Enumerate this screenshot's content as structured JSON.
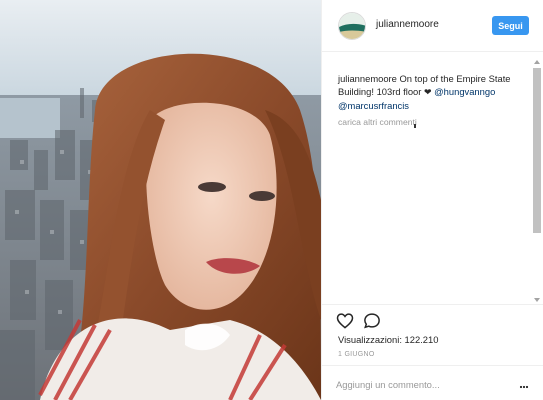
{
  "header": {
    "username": "juliannemoore",
    "follow_label": "Segui"
  },
  "caption": {
    "username": "juliannemoore",
    "text_1": " On top of the Empire State Building! 103rd floor ",
    "heart": "❤",
    "mention_1": "@hungvanngo",
    "mention_2": "@marcusrfrancis"
  },
  "load_more_label": "carica altri commenti",
  "stats": {
    "views_label": "Visualizzazioni:",
    "views_value": "122.210",
    "date": "1 GIUGNO"
  },
  "comment_box": {
    "placeholder": "Aggiungi un commento..."
  },
  "icons": {
    "like": "heart-icon",
    "comment": "comment-icon",
    "more": "more-options-icon"
  },
  "colors": {
    "accent": "#3897f0",
    "mention": "#003569",
    "muted": "#999999"
  }
}
